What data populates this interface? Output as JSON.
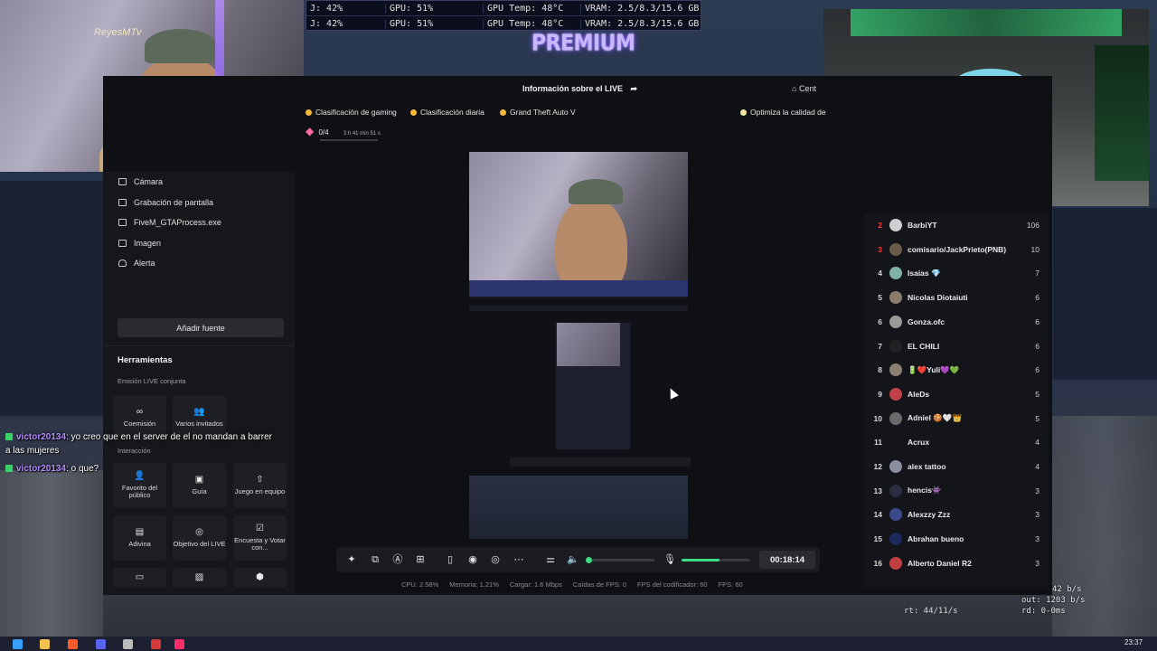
{
  "stats": {
    "row1": [
      "J: 42%",
      "GPU: 51%",
      "GPU Temp: 48°C",
      "VRAM: 2.5/8.3/15.6 GB"
    ],
    "row2": [
      "J: 42%",
      "GPU: 51%",
      "GPU Temp: 48°C",
      "VRAM: 2.5/8.3/15.6 GB"
    ]
  },
  "brand_logo": "PREMIUM",
  "cam_watermark": "ReyesMTv",
  "header": {
    "title": "Información sobre el LIVE",
    "center_label": "Cent"
  },
  "chips": [
    {
      "label": "Clasificación de gaming"
    },
    {
      "label": "Clasificación diaria"
    },
    {
      "label": "Grand Theft Auto V"
    },
    {
      "label": "Optimiza la calidad de"
    }
  ],
  "progress": {
    "count": "0/4",
    "time": "3 h 41 min 51 s"
  },
  "sources": [
    {
      "label": "Cámara",
      "icon": "camera-icon"
    },
    {
      "label": "Grabación de pantalla",
      "icon": "monitor-icon"
    },
    {
      "label": "FiveM_GTAProcess.exe",
      "icon": "app-window-icon"
    },
    {
      "label": "Imagen",
      "icon": "image-icon"
    },
    {
      "label": "Alerta",
      "icon": "bell-icon"
    }
  ],
  "add_source_label": "Añadir fuente",
  "tools": {
    "title": "Herramientas",
    "section_joint": "Emisión LIVE conjunta",
    "section_interaction": "Interacción",
    "joint": [
      {
        "label": "Coemisión",
        "glyph": "∞"
      },
      {
        "label": "Varios invitados",
        "glyph": "👥"
      }
    ],
    "interaction": [
      {
        "label": "Favorito del público",
        "glyph": "👤"
      },
      {
        "label": "Guía",
        "glyph": "▣"
      },
      {
        "label": "Juego en equipo",
        "glyph": "⇧"
      },
      {
        "label": "Adivina",
        "glyph": "▤"
      },
      {
        "label": "Objetivo del LIVE",
        "glyph": "◎"
      },
      {
        "label": "Encuesta y Votar con...",
        "glyph": "☑"
      }
    ]
  },
  "chat": [
    {
      "user": "victor20134",
      "message": ": yo creo que en el server de el no mandan a barrer a las mujeres"
    },
    {
      "user": "victor20134",
      "message": ": o que?"
    }
  ],
  "timer": "00:18:14",
  "status": {
    "cpu": "CPU: 2.58%",
    "memory": "Memoria: 1.21%",
    "upload": "Cargar: 1.6 Mbps",
    "fps_drops": "Caídas de FPS: 0",
    "encoder_fps": "FPS del codificador: 60",
    "fps": "FPS: 60"
  },
  "volume_level": 0.55,
  "leaderboard": [
    {
      "rank": "2",
      "name": "BarbiYT",
      "score": "106",
      "color": "#cfcfcf"
    },
    {
      "rank": "3",
      "name": "comisario/JackPrieto(PNB)",
      "score": "10",
      "color": "#6a5a4a"
    },
    {
      "rank": "4",
      "name": "Isaias 💎",
      "score": "7",
      "color": "#7fb3a8"
    },
    {
      "rank": "5",
      "name": "Nicolas Diotaiuti",
      "score": "6",
      "color": "#8a7a6a"
    },
    {
      "rank": "6",
      "name": "Gonza.ofc",
      "score": "6",
      "color": "#9a9a9a"
    },
    {
      "rank": "7",
      "name": "EL CHILI",
      "score": "6",
      "color": "#222222"
    },
    {
      "rank": "8",
      "name": "🔋❤️Yuli💜💚",
      "score": "6",
      "color": "#8a7f70"
    },
    {
      "rank": "9",
      "name": "AleDs",
      "score": "5",
      "color": "#c0404a"
    },
    {
      "rank": "10",
      "name": "Adniel 🍪🤍👑",
      "score": "5",
      "color": "#6a6a6a"
    },
    {
      "rank": "11",
      "name": "Acrux",
      "score": "4",
      "color": "#14151a"
    },
    {
      "rank": "12",
      "name": "alex tattoo",
      "score": "4",
      "color": "#8a8fa0"
    },
    {
      "rank": "13",
      "name": "hencis👾",
      "score": "3",
      "color": "#2a2e40"
    },
    {
      "rank": "14",
      "name": "Alexzzy Zzz",
      "score": "3",
      "color": "#3a4a8a"
    },
    {
      "rank": "15",
      "name": "Abrahan bueno",
      "score": "3",
      "color": "#1a2a5a"
    },
    {
      "rank": "16",
      "name": "Alberto Daniel R2",
      "score": "3",
      "color": "#c04040"
    }
  ],
  "net": {
    "line1": "42 b/s",
    "line2": "out: 1203 b/s",
    "line3": "rd: 0-0ms",
    "rt": "rt: 44/11/s"
  },
  "clock": "23:37",
  "colors": {
    "accent_green": "#3ddc84",
    "chat_user": "#b58cff",
    "rank_red": "#ff3b3b"
  }
}
